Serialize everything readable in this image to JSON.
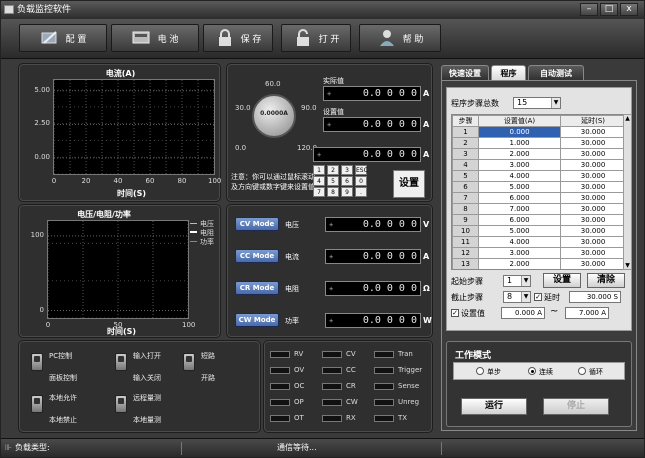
{
  "window": {
    "title": "负载监控软件",
    "min": "–",
    "max": "□",
    "close": "x"
  },
  "toolbar": {
    "config": "配 置",
    "battery": "电 池",
    "save": "保 存",
    "open": "打 开",
    "help": "帮 助"
  },
  "current_chart": {
    "title": "电流(A)",
    "xlabel": "时间(S)"
  },
  "vrp_chart": {
    "title": "电压/电阻/功率",
    "xlabel": "时间(S)",
    "legend": [
      "电压",
      "电阻",
      "功率"
    ]
  },
  "chart_data": [
    {
      "type": "line",
      "title": "电流(A)",
      "xlabel": "时间(S)",
      "ylabel": "",
      "x_ticks": [
        "0",
        "20",
        "40",
        "60",
        "80",
        "100"
      ],
      "y_ticks": [
        "5.00",
        "2.50",
        "0.00"
      ],
      "xlim": [
        0,
        100
      ],
      "ylim": [
        -1.2,
        5.8
      ],
      "grid": true,
      "series": []
    },
    {
      "type": "line",
      "title": "电压/电阻/功率",
      "xlabel": "时间(S)",
      "ylabel": "",
      "x_ticks": [
        "0",
        "50",
        "100"
      ],
      "y_ticks": [
        "100",
        "0"
      ],
      "xlim": [
        0,
        100
      ],
      "ylim": [
        -10,
        120
      ],
      "grid": true,
      "legend_position": "right",
      "series": [
        {
          "name": "电压",
          "values": []
        },
        {
          "name": "电阻",
          "values": []
        },
        {
          "name": "功率",
          "values": []
        }
      ]
    }
  ],
  "dial": {
    "ticks": [
      "0.0",
      "30.0",
      "60.0",
      "90.0",
      "120.0"
    ],
    "center": "0.0000A"
  },
  "setpoint": {
    "actual_label": "实际值",
    "actual_value": "0.0 0 0 0",
    "actual_unit": "A",
    "set_label": "设置值",
    "set_value": "0.0 0 0 0",
    "set_unit": "A",
    "entry_value": "0.0 0 0 0",
    "entry_unit": "A",
    "note1": "注意：你可以通过鼠标滚动",
    "note2": "及方向键或数字键来设置值",
    "keys": [
      "1",
      "2",
      "3",
      "ESC",
      "4",
      "5",
      "6",
      "0",
      "7",
      "8",
      "9",
      "."
    ],
    "set_button": "设置"
  },
  "modes": [
    {
      "button": "CV Mode",
      "label": "电压",
      "value": "0.0 0 0 0",
      "unit": "V"
    },
    {
      "button": "CC Mode",
      "label": "电流",
      "value": "0.0 0 0 0",
      "unit": "A"
    },
    {
      "button": "CR Mode",
      "label": "电阻",
      "value": "0.0 0 0 0",
      "unit": "Ω"
    },
    {
      "button": "CW Mode",
      "label": "功率",
      "value": "0.0 0 0 0",
      "unit": "W"
    }
  ],
  "switches": [
    {
      "top": "PC控制",
      "bottom": "面板控制"
    },
    {
      "top": "输入打开",
      "bottom": "输入关闭"
    },
    {
      "top": "短路",
      "bottom": "开路"
    },
    {
      "top": "本地允许",
      "bottom": "本地禁止"
    },
    {
      "top": "远程量测",
      "bottom": "本地量测"
    }
  ],
  "leds": [
    "RV",
    "CV",
    "Tran",
    "OV",
    "CC",
    "Trigger",
    "OC",
    "CR",
    "Sense",
    "OP",
    "CW",
    "Unreg",
    "OT",
    "RX",
    "TX"
  ],
  "tabs": [
    "快速设置",
    "程序",
    "自动测试"
  ],
  "program": {
    "total_label": "程序步骤总数",
    "total_value": "15",
    "headers": [
      "步骤",
      "设置值(A)",
      "延时(S)"
    ],
    "rows": [
      [
        "1",
        "0.000",
        "30.000"
      ],
      [
        "2",
        "1.000",
        "30.000"
      ],
      [
        "3",
        "2.000",
        "30.000"
      ],
      [
        "4",
        "3.000",
        "30.000"
      ],
      [
        "5",
        "4.000",
        "30.000"
      ],
      [
        "6",
        "5.000",
        "30.000"
      ],
      [
        "7",
        "6.000",
        "30.000"
      ],
      [
        "8",
        "7.000",
        "30.000"
      ],
      [
        "9",
        "6.000",
        "30.000"
      ],
      [
        "10",
        "5.000",
        "30.000"
      ],
      [
        "11",
        "4.000",
        "30.000"
      ],
      [
        "12",
        "3.000",
        "30.000"
      ],
      [
        "13",
        "2.000",
        "30.000"
      ]
    ],
    "start_label": "起始步骤",
    "start_value": "1",
    "end_label": "截止步骤",
    "end_value": "8",
    "set_button": "设置",
    "clear_button": "清除",
    "delay_label": "延时",
    "delay_value": "30.000 S",
    "setvalue_label": "设置值",
    "setvalue_from": "0.000 A",
    "tilde": "~",
    "setvalue_to": "7.000 A"
  },
  "work_mode": {
    "title": "工作模式",
    "options": [
      "单步",
      "连续",
      "循环"
    ],
    "selected": 1,
    "run": "运行",
    "stop": "停止"
  },
  "status": {
    "load_type": "负载类型:",
    "comm": "通信等待..."
  }
}
